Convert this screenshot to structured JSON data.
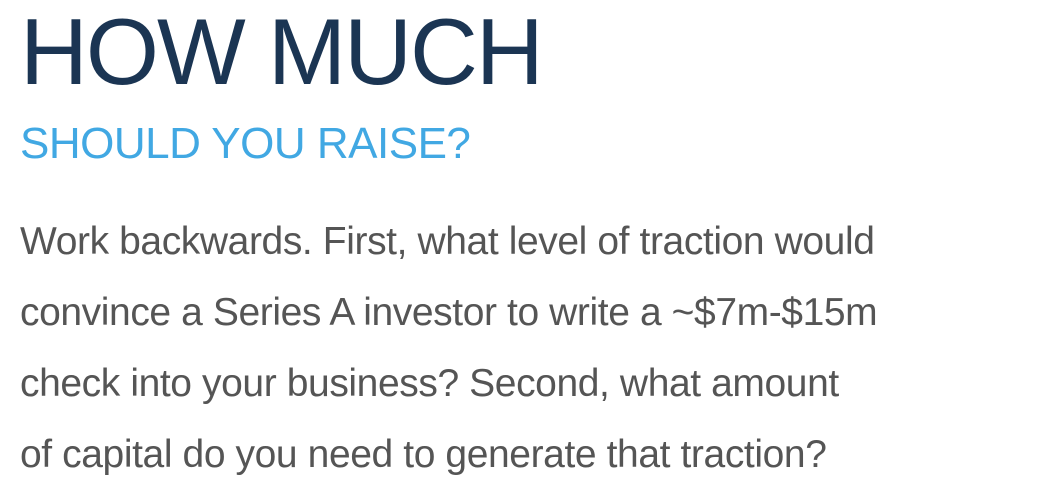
{
  "heading": {
    "main": "HOW MUCH",
    "sub": "SHOULD YOU RAISE?"
  },
  "body": {
    "lines": [
      "Work backwards. First, what level of traction would",
      "convince a Series A investor to write a ~$7m-$15m",
      "check into your business? Second, what amount",
      "of capital do you need to generate that traction?"
    ]
  },
  "colors": {
    "heading_main": "#1b3553",
    "heading_sub": "#41a8e3",
    "body_text": "#555555",
    "background": "#ffffff"
  }
}
